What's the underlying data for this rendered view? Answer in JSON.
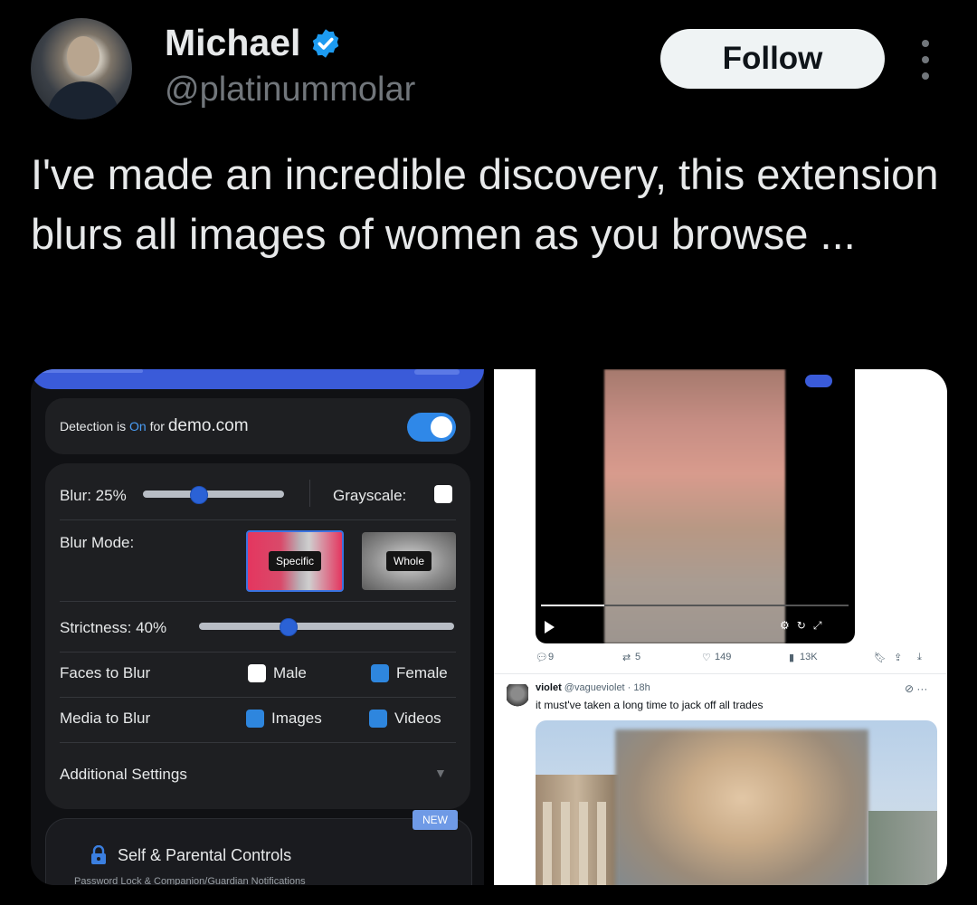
{
  "tweet": {
    "display_name": "Michael",
    "handle": "@platinummolar",
    "follow_label": "Follow",
    "text": "I've made an incredible discovery, this extension blurs all images of women as you browse ..."
  },
  "extension_panel": {
    "detection_prefix": "Detection is ",
    "detection_status": "On",
    "detection_mid": " for ",
    "detection_domain": "demo.com",
    "blur_label": "Blur: 25%",
    "blur_value_pct": 25,
    "grayscale_label": "Grayscale:",
    "blur_mode_label": "Blur Mode:",
    "mode_specific": "Specific",
    "mode_whole": "Whole",
    "strictness_label": "Strictness: 40%",
    "strictness_value_pct": 40,
    "faces_label": "Faces to Blur",
    "faces_options": [
      "Male",
      "Female"
    ],
    "media_label": "Media to Blur",
    "media_options": [
      "Images",
      "Videos"
    ],
    "additional_settings": "Additional Settings",
    "new_badge": "NEW",
    "controls_title": "Self & Parental Controls",
    "controls_subtitle": "Password Lock & Companion/Guardian Notifications"
  },
  "embedded_feed": {
    "action_counts": {
      "replies": "9",
      "reposts": "5",
      "likes": "149",
      "views": "13K"
    },
    "reply": {
      "name": "violet",
      "handle": "@vagueviolet · 18h",
      "text": "it must've taken a long time to jack off all trades"
    }
  },
  "colors": {
    "background": "#000000",
    "verified_blue": "#1d9bf0",
    "accent_blue": "#2f88e8",
    "follow_bg": "#eff3f4"
  }
}
